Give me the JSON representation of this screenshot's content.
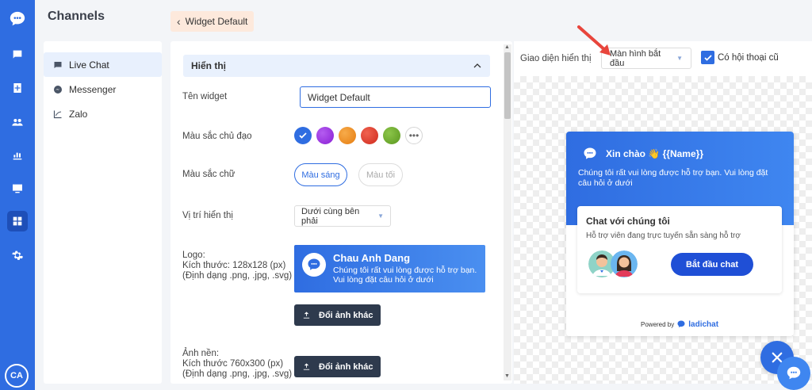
{
  "sidebar": {
    "avatar_initials": "CA",
    "icons": [
      "logo-icon",
      "chat-icon",
      "contacts-icon",
      "users-icon",
      "analytics-icon",
      "display-icon",
      "apps-icon",
      "settings-icon"
    ]
  },
  "channels": {
    "title": "Channels",
    "items": [
      {
        "label": "Live Chat",
        "active": true
      },
      {
        "label": "Messenger",
        "active": false
      },
      {
        "label": "Zalo",
        "active": false
      }
    ]
  },
  "breadcrumb": {
    "label": "Widget Default"
  },
  "settings": {
    "section_title": "Hiển thị",
    "widget_name_label": "Tên widget",
    "widget_name_value": "Widget Default",
    "main_color_label": "Màu sắc chủ đạo",
    "colors": [
      "#2f6de1",
      "#9b30e0",
      "#f08a1c",
      "#e23b2b",
      "#6aa82a"
    ],
    "text_color_label": "Màu sắc chữ",
    "text_color_light": "Màu sáng",
    "text_color_dark": "Màu tối",
    "position_label": "Vị trí hiển thị",
    "position_value": "Dưới cùng bên phải",
    "logo_label_line1": "Logo:",
    "logo_label_line2": "Kích thước: 128x128 (px)",
    "logo_label_line3": "(Định dạng .png, .jpg, .svg)",
    "logo_preview_name": "Chau Anh Dang",
    "logo_preview_desc": "Chúng tôi rất vui lòng được hỗ trợ bạn. Vui lòng đặt câu hỏi ở dưới",
    "change_image_button": "Đổi ảnh khác",
    "background_label_line1": "Ảnh nền:",
    "background_label_line2": "Kích thước 760x300 (px)",
    "background_label_line3": "(Định dạng .png, .jpg, .svg)"
  },
  "preview": {
    "interface_label": "Giao diện hiển thị",
    "mode_value": "Màn hình bắt đầu",
    "old_chat_label": "Có hội thoại cũ",
    "old_chat_checked": true,
    "greeting": "Xin chào 👋 {{Name}}",
    "greeting_sub": "Chúng tôi rất vui lòng được hỗ trợ bạn. Vui lòng đặt câu hỏi ở dưới",
    "card_title": "Chat với chúng tôi",
    "card_sub": "Hỗ trợ viên đang trực tuyến sẵn sàng hỗ trợ",
    "start_button": "Bắt đầu chat",
    "powered_by": "Powered by",
    "brand": "ladichat"
  },
  "colors": {
    "primary": "#2f6de1",
    "dark_button": "#2e3a4d",
    "breadcrumb_bg": "#fde9dc",
    "arrow": "#e8453c"
  }
}
